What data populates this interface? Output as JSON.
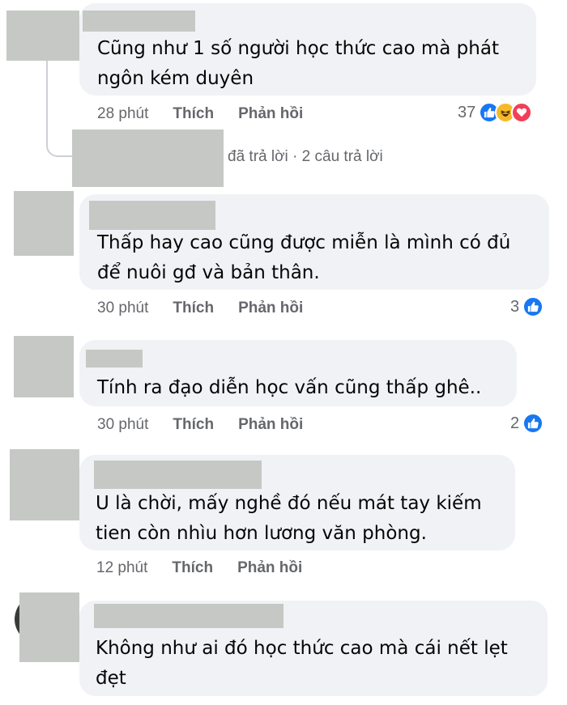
{
  "comments": [
    {
      "text": "Cũng như 1 số người học thức cao mà phát\nngôn kém duyên",
      "time": "28 phút",
      "like_label": "Thích",
      "reply_label": "Phản hồi",
      "reaction_count": "37",
      "reactions": [
        "like-icon",
        "haha-icon",
        "love-icon"
      ]
    },
    {
      "text": "Thấp hay cao cũng được miễn là mình có đủ\nđể nuôi gđ và bản thân.",
      "time": "30 phút",
      "like_label": "Thích",
      "reply_label": "Phản hồi",
      "reaction_count": "3",
      "reactions": [
        "like-icon"
      ]
    },
    {
      "text": "Tính ra đạo diễn học vấn cũng thấp ghê..",
      "time": "30 phút",
      "like_label": "Thích",
      "reply_label": "Phản hồi",
      "reaction_count": "2",
      "reactions": [
        "like-icon"
      ]
    },
    {
      "text": "U là chời, mấy nghề đó nếu mát tay kiếm\ntien còn nhìu hơn lương văn phòng.",
      "time": "12 phút",
      "like_label": "Thích",
      "reply_label": "Phản hồi"
    },
    {
      "text": "Không như ai đó học thức cao mà cái nết lẹt\nđẹt"
    }
  ],
  "reply_thread": {
    "text": "đã trả lời · 2 câu trả lời"
  },
  "colors": {
    "bubble": "#f0f2f5",
    "redacted": "#c5c8c4",
    "like": "#1877f2",
    "haha": "#f7b928",
    "love": "#f33e58",
    "meta": "#65676b"
  }
}
